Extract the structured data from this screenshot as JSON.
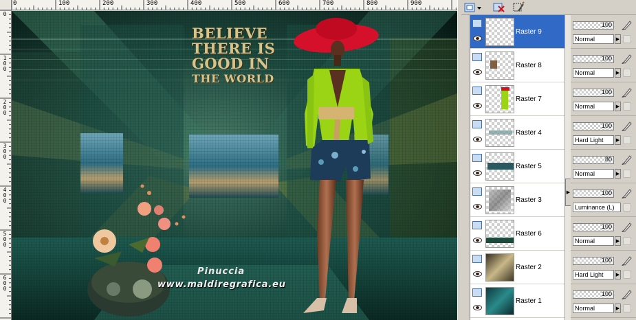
{
  "ruler": {
    "top_labels": [
      "0",
      "100",
      "200",
      "300",
      "400",
      "500",
      "600",
      "700",
      "800",
      "900"
    ],
    "left_labels": [
      "0",
      "100",
      "200",
      "300",
      "400",
      "500",
      "600"
    ]
  },
  "poster": {
    "line1": "BELIEVE",
    "line2": "THERE IS",
    "line3": "GOOD IN",
    "line4": "THE WORLD",
    "signature": "Pinuccia",
    "site": "www.maldiregrafica.eu"
  },
  "toolbar": {
    "new_layer_icon": "new-layer-icon",
    "delete_layer_icon": "delete-layer-icon",
    "mask_icon": "mask-icon"
  },
  "layers": [
    {
      "name": "Raster 9",
      "opacity": "100",
      "blend": "Normal",
      "selected": true
    },
    {
      "name": "Raster 8",
      "opacity": "100",
      "blend": "Normal",
      "selected": false
    },
    {
      "name": "Raster 7",
      "opacity": "100",
      "blend": "Normal",
      "selected": false
    },
    {
      "name": "Raster 4",
      "opacity": "100",
      "blend": "Hard Light",
      "selected": false
    },
    {
      "name": "Raster 5",
      "opacity": "80",
      "blend": "Normal",
      "selected": false
    },
    {
      "name": "Raster 3",
      "opacity": "100",
      "blend": "Luminance (L)",
      "selected": false
    },
    {
      "name": "Raster 6",
      "opacity": "100",
      "blend": "Normal",
      "selected": false
    },
    {
      "name": "Raster 2",
      "opacity": "100",
      "blend": "Hard Light",
      "selected": false
    },
    {
      "name": "Raster 1",
      "opacity": "100",
      "blend": "Normal",
      "selected": false
    }
  ],
  "colors": {
    "selection": "#3169c6",
    "panel": "#d4d0c8",
    "poster_gold": "#d8c48a",
    "jacket_green": "#9ad414",
    "hat_red": "#d4102a"
  }
}
